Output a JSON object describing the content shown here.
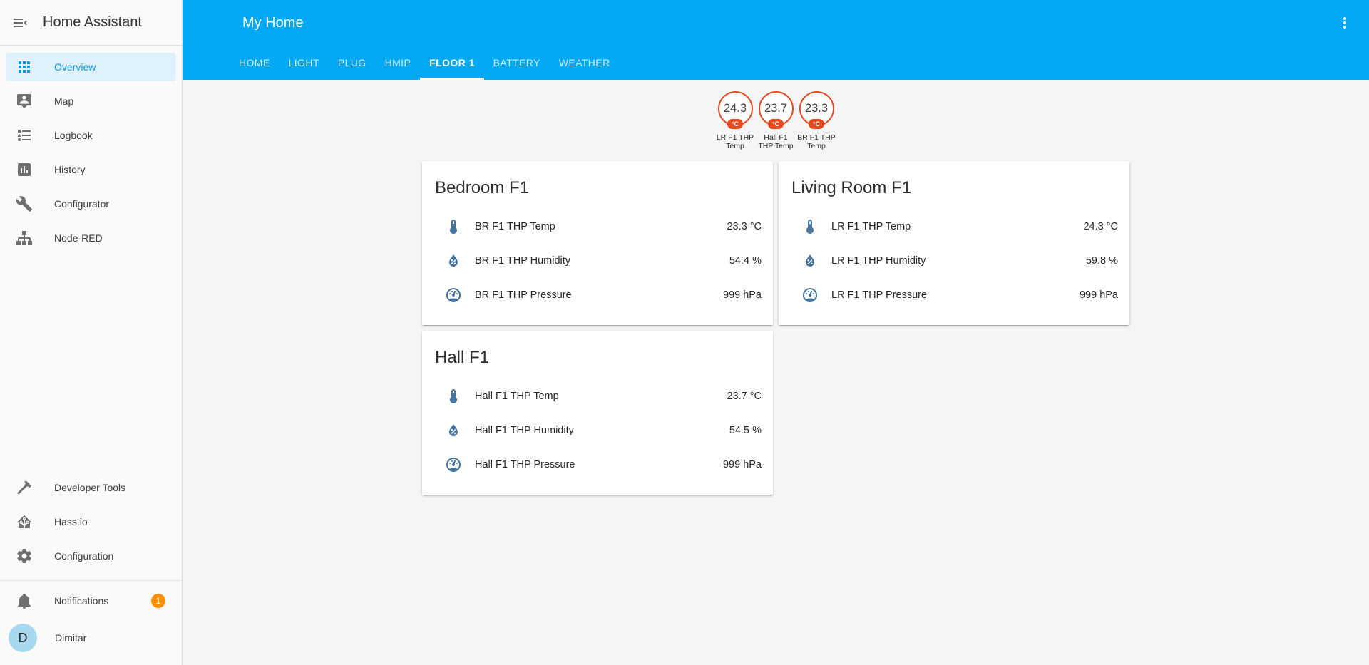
{
  "colors": {
    "primary": "#03a9f4",
    "sidebar_selected_bg": "#dff2fc",
    "sidebar_selected_text": "#0b96d6",
    "badge_accent": "#e8491f",
    "entity_icon": "#44739e",
    "notification_badge": "#fb9007",
    "avatar_bg": "#a8d8f0"
  },
  "sidebar": {
    "title": "Home Assistant",
    "menu_toggle_icon": "menu-collapse-icon",
    "items": [
      {
        "label": "Overview",
        "icon": "apps-grid-icon",
        "selected": true
      },
      {
        "label": "Map",
        "icon": "person-pin-icon",
        "selected": false
      },
      {
        "label": "Logbook",
        "icon": "bulleted-list-icon",
        "selected": false
      },
      {
        "label": "History",
        "icon": "bar-chart-box-icon",
        "selected": false
      },
      {
        "label": "Configurator",
        "icon": "wrench-icon",
        "selected": false
      },
      {
        "label": "Node-RED",
        "icon": "sitemap-icon",
        "selected": false
      }
    ],
    "secondary_items": [
      {
        "label": "Developer Tools",
        "icon": "hammer-icon"
      },
      {
        "label": "Hass.io",
        "icon": "home-assistant-logo-icon"
      },
      {
        "label": "Configuration",
        "icon": "gear-icon"
      }
    ],
    "notifications": {
      "label": "Notifications",
      "icon": "bell-icon",
      "count": "1"
    },
    "profile": {
      "name": "Dimitar",
      "initial": "D"
    }
  },
  "header": {
    "title": "My Home",
    "overflow_icon": "kebab-menu-icon",
    "tabs": [
      {
        "label": "HOME",
        "active": false
      },
      {
        "label": "LIGHT",
        "active": false
      },
      {
        "label": "PLUG",
        "active": false
      },
      {
        "label": "HMIP",
        "active": false
      },
      {
        "label": "FLOOR 1",
        "active": true
      },
      {
        "label": "BATTERY",
        "active": false
      },
      {
        "label": "WEATHER",
        "active": false
      }
    ]
  },
  "badges": [
    {
      "value": "24.3",
      "unit": "°C",
      "label": "LR F1 THP Temp"
    },
    {
      "value": "23.7",
      "unit": "°C",
      "label": "Hall F1 THP Temp"
    },
    {
      "value": "23.3",
      "unit": "°C",
      "label": "BR F1 THP Temp"
    }
  ],
  "cards": [
    {
      "title": "Bedroom F1",
      "rows": [
        {
          "icon": "thermometer-icon",
          "label": "BR F1 THP Temp",
          "value": "23.3 °C"
        },
        {
          "icon": "water-percent-icon",
          "label": "BR F1 THP Humidity",
          "value": "54.4 %"
        },
        {
          "icon": "gauge-icon",
          "label": "BR F1 THP Pressure",
          "value": "999 hPa"
        }
      ]
    },
    {
      "title": "Living Room F1",
      "rows": [
        {
          "icon": "thermometer-icon",
          "label": "LR F1 THP Temp",
          "value": "24.3 °C"
        },
        {
          "icon": "water-percent-icon",
          "label": "LR F1 THP Humidity",
          "value": "59.8 %"
        },
        {
          "icon": "gauge-icon",
          "label": "LR F1 THP Pressure",
          "value": "999 hPa"
        }
      ]
    },
    {
      "title": "Hall F1",
      "rows": [
        {
          "icon": "thermometer-icon",
          "label": "Hall F1 THP Temp",
          "value": "23.7 °C"
        },
        {
          "icon": "water-percent-icon",
          "label": "Hall F1 THP Humidity",
          "value": "54.5 %"
        },
        {
          "icon": "gauge-icon",
          "label": "Hall F1 THP Pressure",
          "value": "999 hPa"
        }
      ]
    }
  ]
}
